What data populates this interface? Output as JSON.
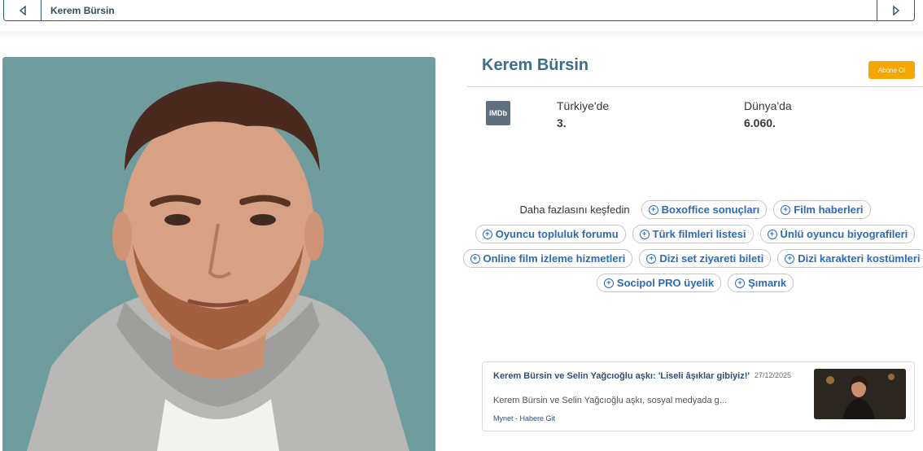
{
  "topbar": {
    "title": "Kerem Bürsin"
  },
  "profile": {
    "name": "Kerem Bürsin",
    "subscribe_label": "Abone Ol",
    "imdb_label": "IMDb",
    "rank_local_label": "Türkiye'de",
    "rank_local_value": "3.",
    "rank_world_label": "Dünya'da",
    "rank_world_value": "6.060."
  },
  "explore": {
    "lead": "Daha fazlasını keşfedin",
    "links": [
      "Boxoffice sonuçları",
      "Film haberleri",
      "Oyuncu topluluk forumu",
      "Türk filmleri listesi",
      "Ünlü oyuncu biyografileri",
      "Online film izleme hizmetleri",
      "Dizi set ziyareti bileti",
      "Dizi karakteri kostümleri",
      "Socipol PRO üyelik",
      "Şımarık"
    ]
  },
  "news": {
    "headline": "Kerem Bürsin ve Selin Yağcıoğlu aşkı: 'Liseli âşıklar gibiyiz!'",
    "date": "27/12/2025",
    "summary": "Kerem Bürsin ve Selin Yağcıoğlu aşkı, sosyal medyada g...",
    "source": "Mynet - Habere Git"
  },
  "colors": {
    "accent": "#3a6f86",
    "subscribe": "#f6a600",
    "link": "#2a6bbd"
  }
}
